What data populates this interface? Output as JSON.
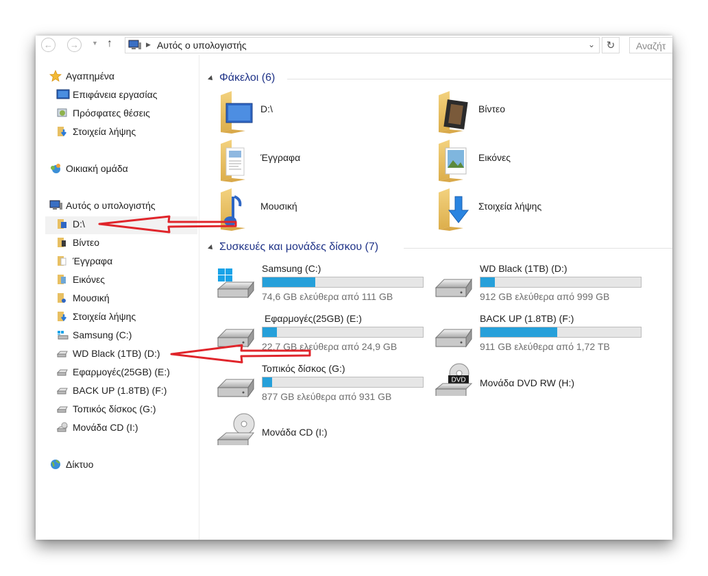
{
  "address_bar": {
    "back_icon": "arrow-left-icon",
    "forward_icon": "arrow-right-icon",
    "up_icon": "arrow-up-icon",
    "path": "Αυτός ο υπολογιστής",
    "refresh_icon": "refresh-icon",
    "search_placeholder": "Αναζήτ"
  },
  "nav_pane": {
    "favorites": {
      "label": "Αγαπημένα",
      "items": [
        "Επιφάνεια εργασίας",
        "Πρόσφατες θέσεις",
        "Στοιχεία λήψης"
      ]
    },
    "homegroup": "Οικιακή ομάδα",
    "this_pc": {
      "label": "Αυτός ο υπολογιστής",
      "items": [
        "D:\\",
        "Βίντεο",
        "Έγγραφα",
        "Εικόνες",
        "Μουσική",
        "Στοιχεία λήψης",
        "Samsung (C:)",
        "WD Black (1TB) (D:)",
        "Εφαρμογές(25GB) (E:)",
        "BACK UP (1.8TB) (F:)",
        "Τοπικός δίσκος (G:)",
        "Μονάδα CD (I:)"
      ]
    },
    "network": "Δίκτυο"
  },
  "folders_group": {
    "title": "Φάκελοι (6)",
    "items": [
      "D:\\",
      "Βίντεο",
      "Έγγραφα",
      "Εικόνες",
      "Μουσική",
      "Στοιχεία λήψης"
    ]
  },
  "devices_group": {
    "title": "Συσκευές και μονάδες δίσκου (7)",
    "drives": [
      {
        "name": "Samsung (C:)",
        "free": "74,6 GB ελεύθερα από 111 GB",
        "used_fraction": 0.33,
        "icon": "windows-drive-icon"
      },
      {
        "name": "WD Black (1TB) (D:)",
        "free": "912 GB ελεύθερα από 999 GB",
        "used_fraction": 0.09,
        "icon": "hard-drive-icon"
      },
      {
        "name": "Εφαρμογές(25GB) (E:)",
        "free": "22,7 GB ελεύθερα από 24,9 GB",
        "used_fraction": 0.09,
        "icon": "hard-drive-icon"
      },
      {
        "name": "BACK UP (1.8TB) (F:)",
        "free": "911 GB ελεύθερα από 1,72 TB",
        "used_fraction": 0.48,
        "icon": "hard-drive-icon"
      },
      {
        "name": "Τοπικός δίσκος (G:)",
        "free": "877 GB ελεύθερα από 931 GB",
        "used_fraction": 0.06,
        "icon": "hard-drive-icon"
      },
      {
        "name": "Μονάδα DVD RW (H:)",
        "icon": "dvd-drive-icon",
        "badge": "DVD"
      },
      {
        "name": "Μονάδα CD (I:)",
        "icon": "cd-drive-icon"
      }
    ]
  },
  "colors": {
    "accent": "#26a0da",
    "group_title": "#1e3287",
    "annotation_arrow": "#e0252b"
  }
}
